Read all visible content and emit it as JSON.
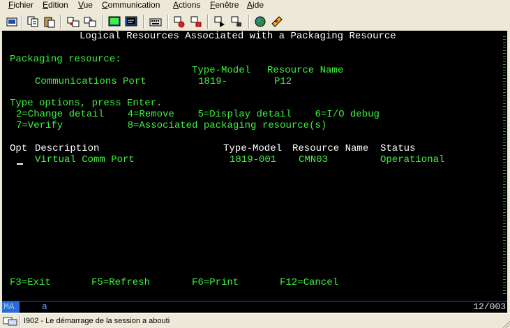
{
  "menu": [
    "Fichier",
    "Edition",
    "Vue",
    "Communication",
    "Actions",
    "Fenêtre",
    "Aide"
  ],
  "toolbar": {
    "buttons": [
      "print-screen-icon",
      "copy-icon",
      "paste-icon",
      "send-file-icon",
      "receive-file-icon",
      "display-icon",
      "macro-icon",
      "record-macro-icon",
      "stop-macro-icon",
      "play-macro-icon",
      "keypad-icon",
      "color-icon",
      "help-icon"
    ]
  },
  "screen": {
    "title": "Logical Resources Associated with a Packaging Resource",
    "packaging_label": "Packaging resource:",
    "header_type_model": "Type-Model",
    "header_resource_name": "Resource Name",
    "pkg_description": "Communications Port",
    "pkg_type_model": "1819-",
    "pkg_resource_name": "P12",
    "instructions": "Type options, press Enter.",
    "options_line1": "2=Change detail    4=Remove    5=Display detail    6=I/O debug",
    "options_line2": "7=Verify           8=Associated packaging resource(s)",
    "list_headers": {
      "opt": "Opt",
      "description": "Description",
      "type_model": "Type-Model",
      "resource_name": "Resource Name",
      "status": "Status"
    },
    "rows": [
      {
        "description": "Virtual Comm Port",
        "type_model": "1819-001",
        "resource_name": "CMN03",
        "status": "Operational"
      }
    ],
    "function_keys": [
      "F3=Exit",
      "F5=Refresh",
      "F6=Print",
      "F12=Cancel"
    ]
  },
  "oia": {
    "mode": "MA",
    "indicator": "a",
    "cursor_pos": "12/003"
  },
  "status_bar": {
    "message": "I902 - Le démarrage de la session a abouti"
  }
}
